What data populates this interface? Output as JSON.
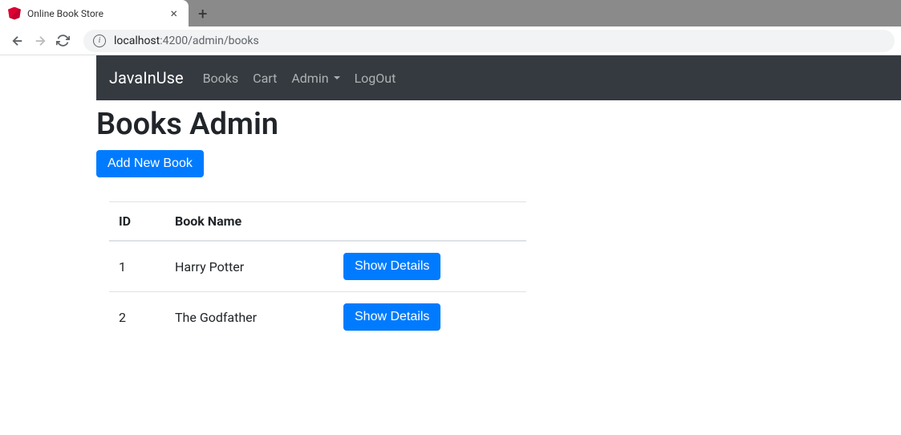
{
  "browser": {
    "tab_title": "Online Book Store",
    "url_host": "localhost",
    "url_port_path": ":4200/admin/books"
  },
  "navbar": {
    "brand": "JavaInUse",
    "links": {
      "books": "Books",
      "cart": "Cart",
      "admin": "Admin",
      "logout": "LogOut"
    }
  },
  "page": {
    "title": "Books Admin",
    "add_button": "Add New Book"
  },
  "table": {
    "headers": {
      "id": "ID",
      "name": "Book Name"
    },
    "rows": [
      {
        "id": "1",
        "name": "Harry Potter",
        "action": "Show Details"
      },
      {
        "id": "2",
        "name": "The Godfather",
        "action": "Show Details"
      }
    ]
  }
}
